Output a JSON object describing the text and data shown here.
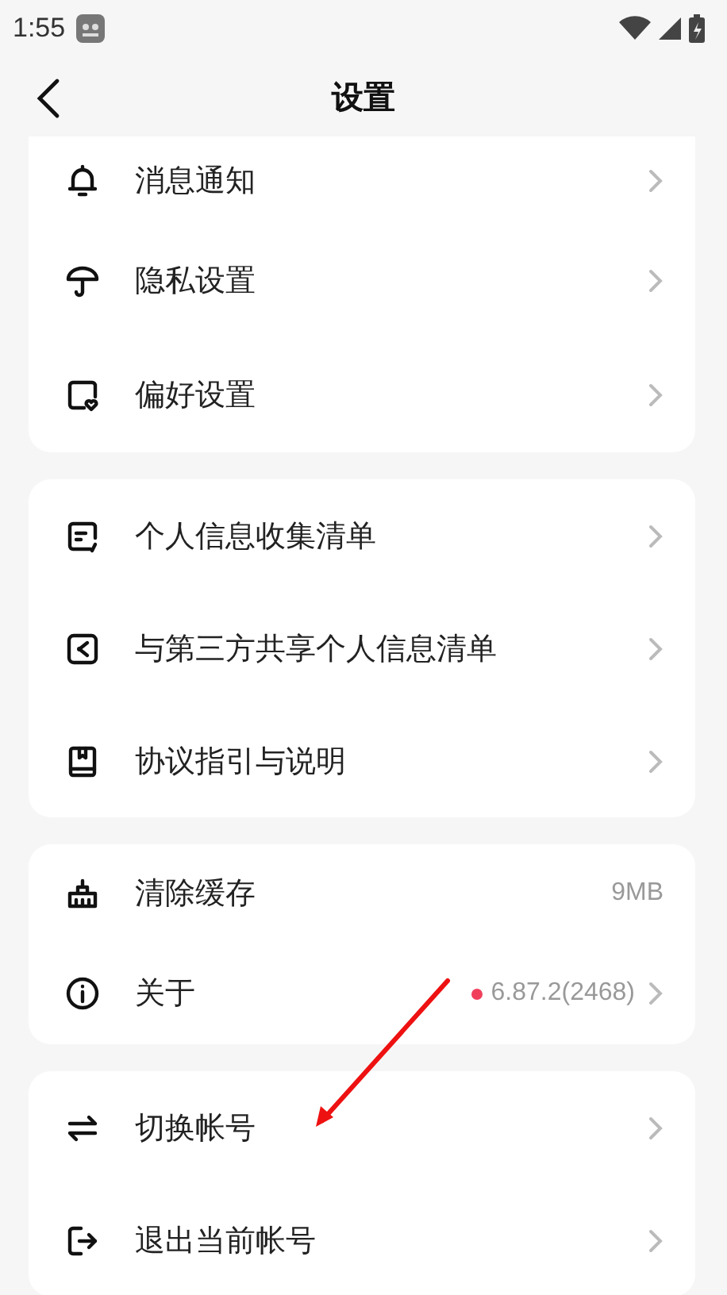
{
  "status_bar": {
    "time": "1:55"
  },
  "header": {
    "title": "设置"
  },
  "groups": [
    {
      "items": [
        {
          "label": "消息通知",
          "chevron": true
        },
        {
          "label": "隐私设置",
          "chevron": true
        },
        {
          "label": "偏好设置",
          "chevron": true
        }
      ]
    },
    {
      "items": [
        {
          "label": "个人信息收集清单",
          "chevron": true
        },
        {
          "label": "与第三方共享个人信息清单",
          "chevron": true
        },
        {
          "label": "协议指引与说明",
          "chevron": true
        }
      ]
    },
    {
      "items": [
        {
          "label": "清除缓存",
          "value": "9MB",
          "chevron": false
        },
        {
          "label": "关于",
          "value": "6.87.2(2468)",
          "badge": true,
          "chevron": true
        }
      ]
    },
    {
      "items": [
        {
          "label": "切换帐号",
          "chevron": true
        },
        {
          "label": "退出当前帐号",
          "chevron": true
        }
      ]
    }
  ]
}
